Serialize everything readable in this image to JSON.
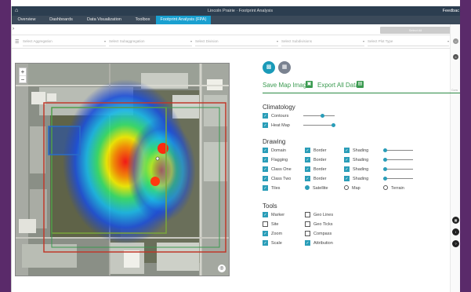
{
  "topbar": {
    "home_icon": "home-icon",
    "title": "Lincoln Prairie · Footprint Analysis",
    "feedback": "Feedbac"
  },
  "nav": {
    "tabs": [
      "Overview",
      "Dashboards",
      "Data Visualization",
      "Toolbox",
      "Footprint Analysis (FPA)"
    ],
    "active_index": 4
  },
  "strip": {
    "load_button": "Select All"
  },
  "filters": {
    "items": [
      "Select Aggregation",
      "Select Subaggregation",
      "Select Division",
      "Select Subdivisions",
      "Select Plot Type"
    ]
  },
  "rail": {
    "label": "Cons"
  },
  "panel": {
    "save_map": "Save Map Image",
    "export": "Export All Data",
    "climatology": {
      "title": "Climatology",
      "items": [
        "Contours",
        "Heat Map"
      ]
    },
    "drawing": {
      "title": "Drawing",
      "rows": [
        {
          "name": "Domain",
          "border": "Border",
          "shading": "Shading"
        },
        {
          "name": "Flagging",
          "border": "Border",
          "shading": "Shading"
        },
        {
          "name": "Class One",
          "border": "Border",
          "shading": "Shading"
        },
        {
          "name": "Class Two",
          "border": "Border",
          "shading": "Shading"
        }
      ],
      "tiles": "Tiles",
      "tile_options": [
        "Satellite",
        "Map",
        "Terrain"
      ],
      "selected_tile": "Satellite"
    },
    "tools": {
      "title": "Tools",
      "left": [
        "Marker",
        "Site",
        "Zoom",
        "Scale"
      ],
      "right": [
        "Geo Lines",
        "Geo Ticks",
        "Compass",
        "Attribution"
      ],
      "checked": {
        "Marker": true,
        "Site": false,
        "Zoom": true,
        "Scale": true,
        "Geo Lines": false,
        "Geo Ticks": false,
        "Compass": false,
        "Attribution": true
      }
    }
  },
  "colors": {
    "accent": "#2a9db8",
    "green": "#3a9a50",
    "nav_active": "#1aa0d0",
    "topbar": "#2c3e50"
  }
}
